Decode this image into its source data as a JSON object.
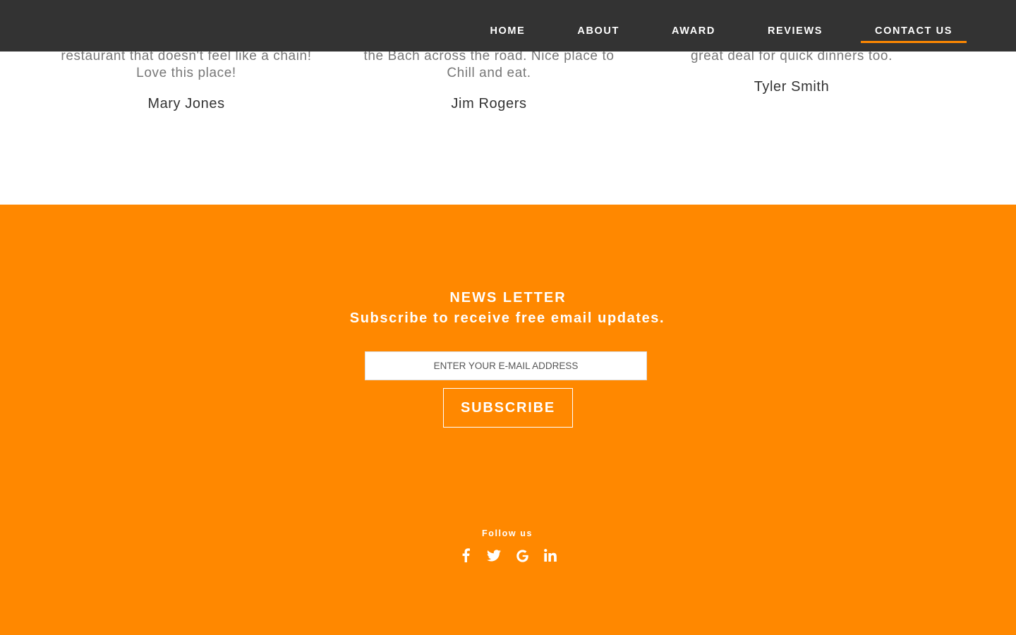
{
  "nav": {
    "items": [
      {
        "label": "HOME"
      },
      {
        "label": "ABOUT"
      },
      {
        "label": "AWARD"
      },
      {
        "label": "REVIEWS"
      },
      {
        "label": "CONTACT US",
        "active": true
      }
    ]
  },
  "reviews": [
    {
      "text": "restaurant that doesn't feel like a chain! Love this place!",
      "author": "Mary Jones"
    },
    {
      "text": "the Bach across the road. Nice place to Chill and eat.",
      "author": "Jim Rogers"
    },
    {
      "text": "great deal for quick dinners too.",
      "author": "Tyler Smith"
    }
  ],
  "newsletter": {
    "title": "NEWS LETTER",
    "subtitle": "Subscribe to receive free email updates.",
    "email_placeholder": "ENTER YOUR E-MAIL ADDRESS",
    "subscribe_label": "SUBSCRIBE"
  },
  "follow": {
    "label": "Follow us",
    "icons": [
      "facebook-icon",
      "twitter-icon",
      "google-icon",
      "linkedin-icon"
    ]
  },
  "colors": {
    "nav_bg": "#333333",
    "accent": "#ff8800",
    "review_text": "#777777",
    "review_author": "#333333"
  }
}
